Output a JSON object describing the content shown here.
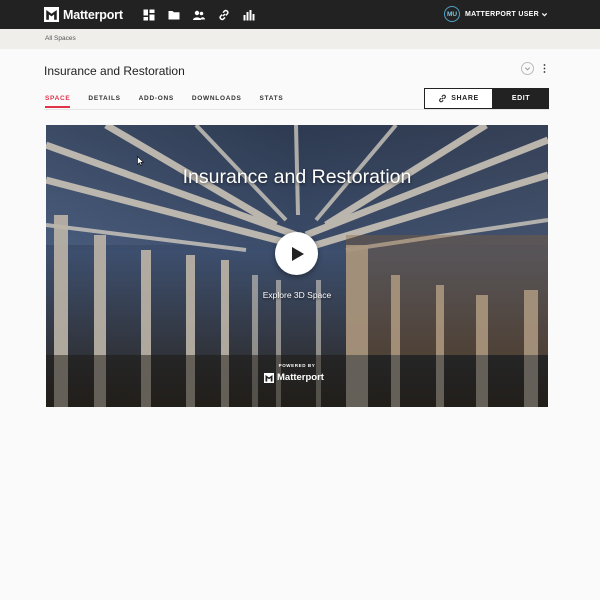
{
  "brand": {
    "name": "Matterport"
  },
  "nav": {
    "icons": [
      "dashboard-icon",
      "folder-icon",
      "users-icon",
      "link-icon",
      "stats-icon"
    ],
    "user": {
      "initials": "MU",
      "name": "MATTERPORT USER"
    }
  },
  "breadcrumb": "All Spaces",
  "space": {
    "title": "Insurance and Restoration",
    "tabs": [
      {
        "label": "SPACE",
        "active": true
      },
      {
        "label": "DETAILS",
        "active": false
      },
      {
        "label": "ADD-ONS",
        "active": false
      },
      {
        "label": "DOWNLOADS",
        "active": false
      },
      {
        "label": "STATS",
        "active": false
      }
    ],
    "share_label": "SHARE",
    "edit_label": "EDIT"
  },
  "viewer": {
    "title": "Insurance and Restoration",
    "cta": "Explore 3D Space",
    "powered_by": "POWERED BY",
    "brand": "Matterport"
  },
  "colors": {
    "topbar": "#222222",
    "accent": "#e0324b",
    "breadcrumb_bg": "#f0eeeb",
    "page_bg": "#fafafa"
  }
}
